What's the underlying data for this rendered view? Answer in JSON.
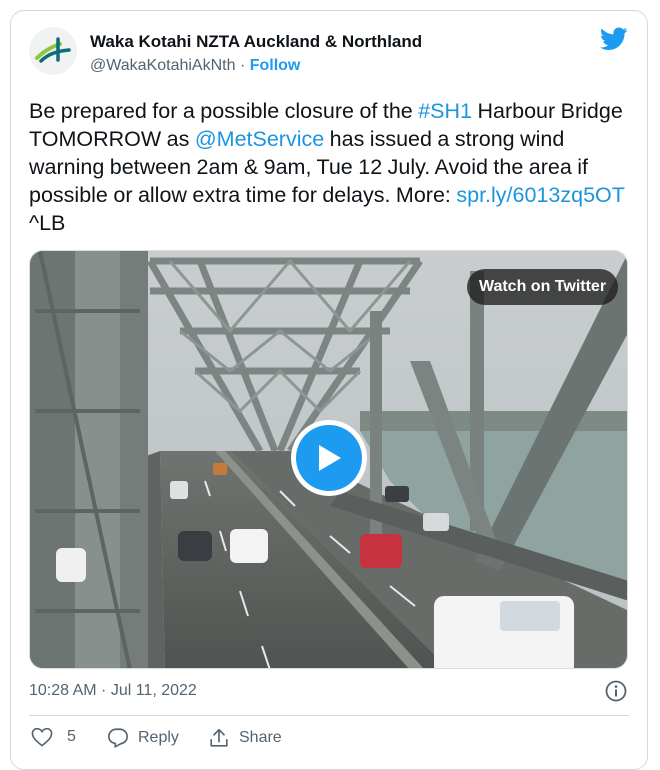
{
  "author": {
    "name": "Waka Kotahi NZTA Auckland & Northland",
    "handle": "@WakaKotahiAkNth",
    "separator": "·",
    "follow_label": "Follow"
  },
  "tweet": {
    "text_1": "Be prepared for a possible closure of the ",
    "hashtag": "#SH1",
    "text_2": " Harbour Bridge TOMORROW as ",
    "mention": "@MetService",
    "text_3": " has issued a strong wind warning between 2am & 9am, Tue 12 July. Avoid the area if possible or allow extra time for delays. More: ",
    "url": "spr.ly/6013zq5OT",
    "text_4": " ^LB"
  },
  "media": {
    "watch_label": "Watch on Twitter",
    "play_icon": "play-icon"
  },
  "timestamp": "10:28 AM · Jul 11, 2022",
  "actions": {
    "like_count": "5",
    "reply_label": "Reply",
    "share_label": "Share"
  },
  "colors": {
    "accent": "#1d9bf0",
    "text": "#0f1419",
    "secondary": "#536471"
  }
}
